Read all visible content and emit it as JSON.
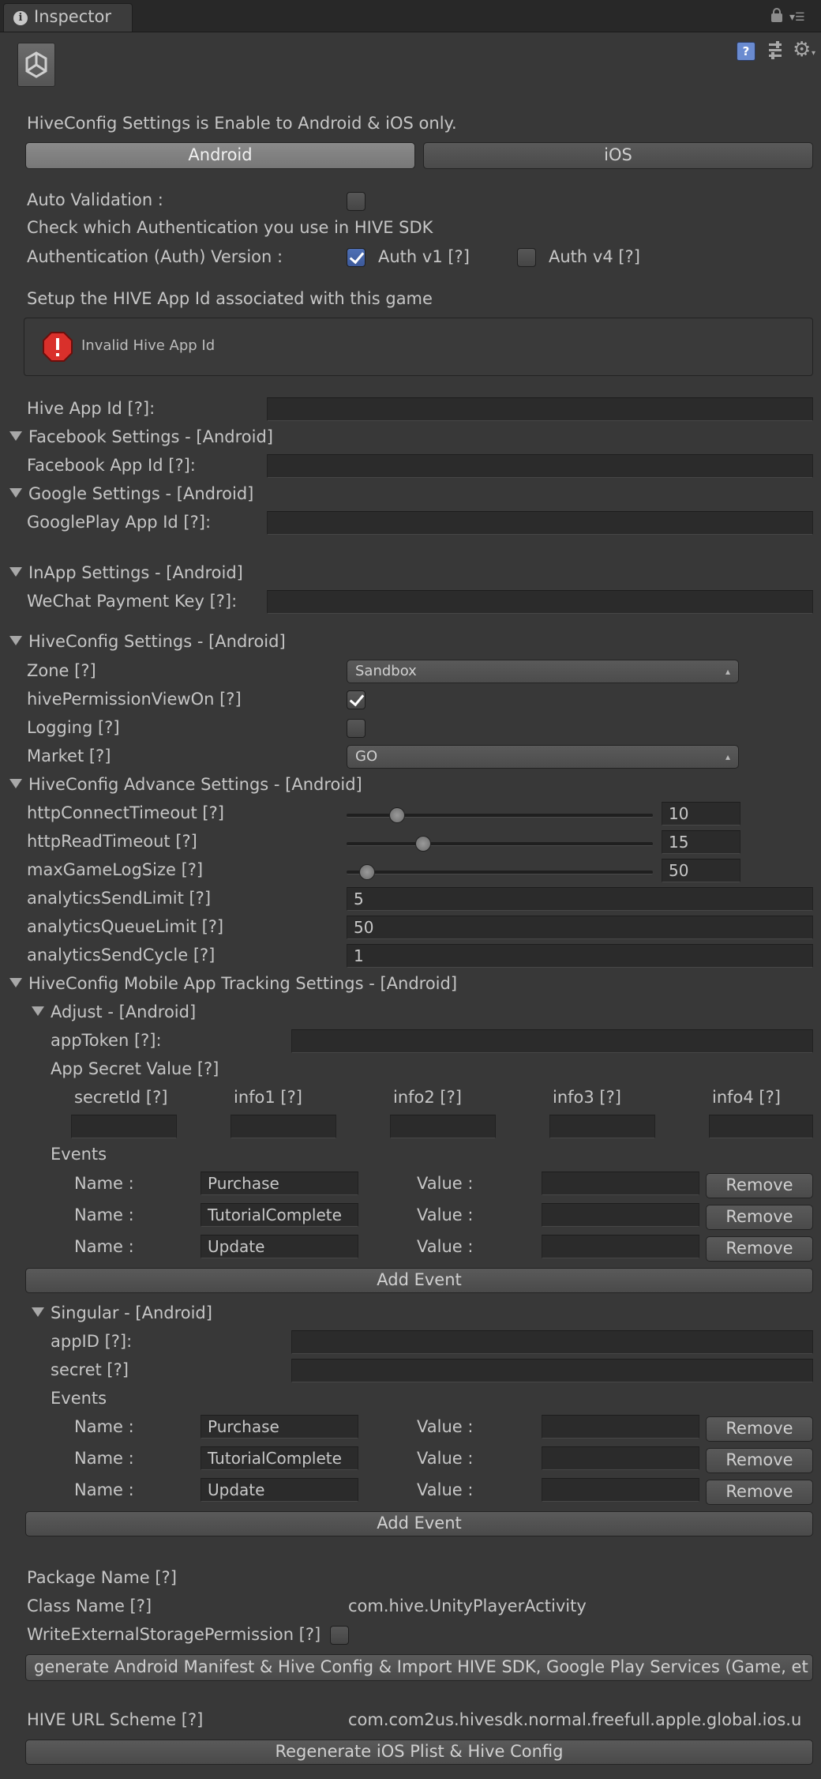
{
  "tab": {
    "icon": "info-icon",
    "title": "Inspector"
  },
  "header_note": "HiveConfig Settings is Enable to Android & iOS only.",
  "platform_tabs": {
    "android": "Android",
    "ios": "iOS"
  },
  "auth": {
    "auto_validation": "Auto Validation :",
    "check_text": "Check which Authentication you use in HIVE SDK",
    "version_label": "Authentication (Auth) Version :",
    "v1": "Auth v1 [?]",
    "v4": "Auth v4 [?]"
  },
  "setup_text": "Setup the HIVE App Id associated with this game",
  "error_text": "Invalid Hive App Id",
  "hive_app_id": "Hive App Id [?]:",
  "facebook": {
    "header": "Facebook Settings - [Android]",
    "label": "Facebook App Id [?]:"
  },
  "google": {
    "header": "Google Settings - [Android]",
    "label": "GooglePlay App Id [?]:"
  },
  "inapp": {
    "header": "InApp Settings  - [Android]",
    "label": "WeChat Payment Key [?]:"
  },
  "hiveconfig": {
    "header": "HiveConfig Settings - [Android]",
    "zone_label": "Zone [?]",
    "zone_value": "Sandbox",
    "permission_label": "hivePermissionViewOn [?]",
    "logging_label": "Logging [?]",
    "market_label": "Market [?]",
    "market_value": "GO"
  },
  "advance": {
    "header": "HiveConfig Advance Settings - [Android]",
    "connect_label": "httpConnectTimeout [?]",
    "connect_value": "10",
    "connect_fraction": 0.16,
    "read_label": "httpReadTimeout [?]",
    "read_value": "15",
    "read_fraction": 0.25,
    "log_label": "maxGameLogSize [?]",
    "log_value": "50",
    "log_fraction": 0.06,
    "send_limit_label": "analyticsSendLimit [?]",
    "send_limit_value": "5",
    "queue_limit_label": "analyticsQueueLimit [?]",
    "queue_limit_value": "50",
    "send_cycle_label": "analyticsSendCycle [?]",
    "send_cycle_value": "1"
  },
  "tracking": {
    "header": "HiveConfig Mobile App Tracking Settings - [Android]"
  },
  "adjust": {
    "header": "Adjust - [Android]",
    "app_token": "appToken [?]:",
    "secret_value": "App Secret Value [?]",
    "cols": [
      "secretId [?]",
      "info1 [?]",
      "info2 [?]",
      "info3 [?]",
      "info4 [?]"
    ],
    "events_label": "Events",
    "name_label": "Name :",
    "value_label": "Value :",
    "remove": "Remove",
    "events": [
      "Purchase",
      "TutorialComplete",
      "Update"
    ],
    "add_event": "Add Event"
  },
  "singular": {
    "header": "Singular - [Android]",
    "app_id": "appID [?]:",
    "secret": "secret [?]",
    "events_label": "Events",
    "name_label": "Name :",
    "value_label": "Value :",
    "remove": "Remove",
    "events": [
      "Purchase",
      "TutorialComplete",
      "Update"
    ],
    "add_event": "Add Event"
  },
  "footer": {
    "package_name": "Package Name [?]",
    "class_name": "Class Name [?]",
    "class_value": "com.hive.UnityPlayerActivity",
    "write_perm": "WriteExternalStoragePermission [?]",
    "generate_btn": "generate Android Manifest & Hive Config & Import HIVE SDK, Google Play Services (Game, et",
    "url_scheme": "HIVE URL Scheme [?]",
    "url_value": "com.com2us.hivesdk.normal.freefull.apple.global.ios.u",
    "regen_btn": "Regenerate iOS Plist & Hive Config"
  }
}
